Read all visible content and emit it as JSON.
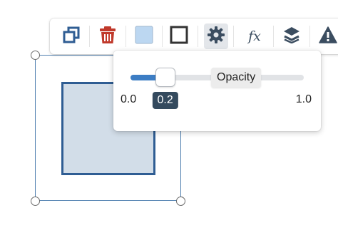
{
  "toolbar": {
    "buttons": [
      {
        "name": "duplicate-icon"
      },
      {
        "name": "trash-icon",
        "color": "#c0392b"
      },
      {
        "name": "fill-color-icon",
        "color": "#bcd7f1"
      },
      {
        "name": "stroke-icon"
      },
      {
        "name": "gear-icon",
        "active": true
      },
      {
        "name": "fx-icon",
        "label": "fx"
      },
      {
        "name": "layers-icon"
      },
      {
        "name": "warning-icon"
      }
    ]
  },
  "opacity_popup": {
    "tooltip": "Opacity",
    "min_label": "0.0",
    "max_label": "1.0",
    "value_label": "0.2",
    "value": 0.2,
    "accent": "#3c7dc4"
  },
  "shape": {
    "fill": "#d2dde8",
    "stroke": "#2f5d93"
  }
}
